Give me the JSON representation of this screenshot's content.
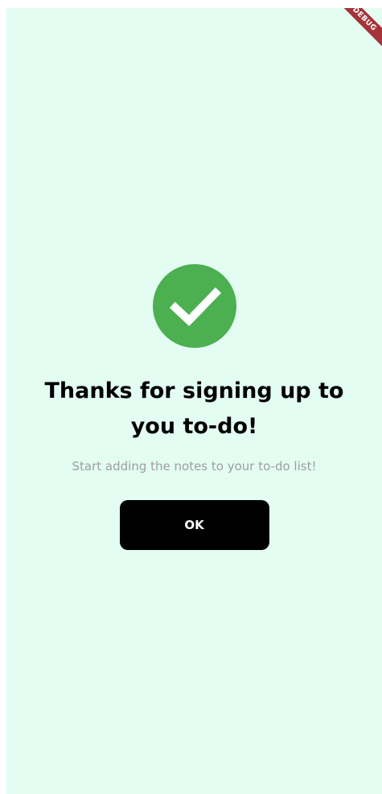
{
  "debug_banner": {
    "label": "DEBUG",
    "color": "#a4343a"
  },
  "success": {
    "icon": "check-circle-icon",
    "color": "#4caf50",
    "check_color": "#ffffff"
  },
  "dialog": {
    "title": "Thanks for signing up to you to-do!",
    "subtitle": "Start adding the notes to your to-do list!",
    "button_label": "OK",
    "button_color": "#000000"
  },
  "colors": {
    "background": "#e3fdf3",
    "subtitle": "#9e9e9e"
  }
}
